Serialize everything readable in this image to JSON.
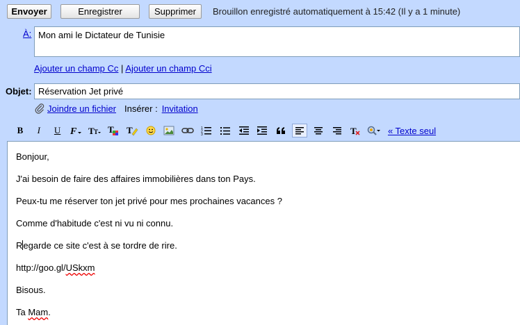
{
  "toolbar": {
    "send_label": "Envoyer",
    "save_label": "Enregistrer",
    "delete_label": "Supprimer",
    "status": "Brouillon enregistré automatiquement à 15:42 (Il y a 1 minute)"
  },
  "to": {
    "label": "À:",
    "value": "Mon ami le Dictateur de Tunisie"
  },
  "cc": {
    "add_cc": "Ajouter un champ Cc",
    "separator": "|",
    "add_bcc": "Ajouter un champ Cci"
  },
  "subject": {
    "label": "Objet:",
    "value": "Réservation Jet privé"
  },
  "attach": {
    "attach_label": "Joindre un fichier",
    "insert_label": "Insérer :",
    "invitation_label": "Invitation"
  },
  "format": {
    "bold": "B",
    "italic": "I",
    "underline": "U",
    "plain_text_link": "« Texte seul",
    "icons": [
      "bold-icon",
      "italic-icon",
      "underline-icon",
      "font-icon",
      "font-size-icon",
      "text-color-icon",
      "highlight-icon",
      "emoticon-icon",
      "image-icon",
      "link-icon",
      "numbered-list-icon",
      "bullet-list-icon",
      "indent-less-icon",
      "indent-more-icon",
      "quote-icon",
      "align-left-icon",
      "align-center-icon",
      "align-right-icon",
      "remove-format-icon",
      "spell-check-icon"
    ]
  },
  "body": {
    "lines": [
      "Bonjour,",
      "J'ai besoin de faire des affaires immobilières dans ton Pays.",
      "Peux-tu me réserver ton jet privé pour mes prochaines vacances ?",
      "Comme d'habitude c'est ni vu ni connu.",
      "Regarde ce site c'est à se tordre de rire.",
      "http://goo.gl/USkxm",
      "Bisous.",
      "Ta Mam."
    ],
    "line5_a": "R",
    "line5_b": "egarde ce site c'est à se tordre de rire.",
    "line6_a": "http://goo.gl/",
    "line6_b": "USkxm",
    "line8_a": "Ta ",
    "line8_b": "Mam",
    "line8_c": "."
  },
  "colors": {
    "background": "#c3d9ff",
    "link": "#0000cc",
    "border": "#7f9db9"
  }
}
